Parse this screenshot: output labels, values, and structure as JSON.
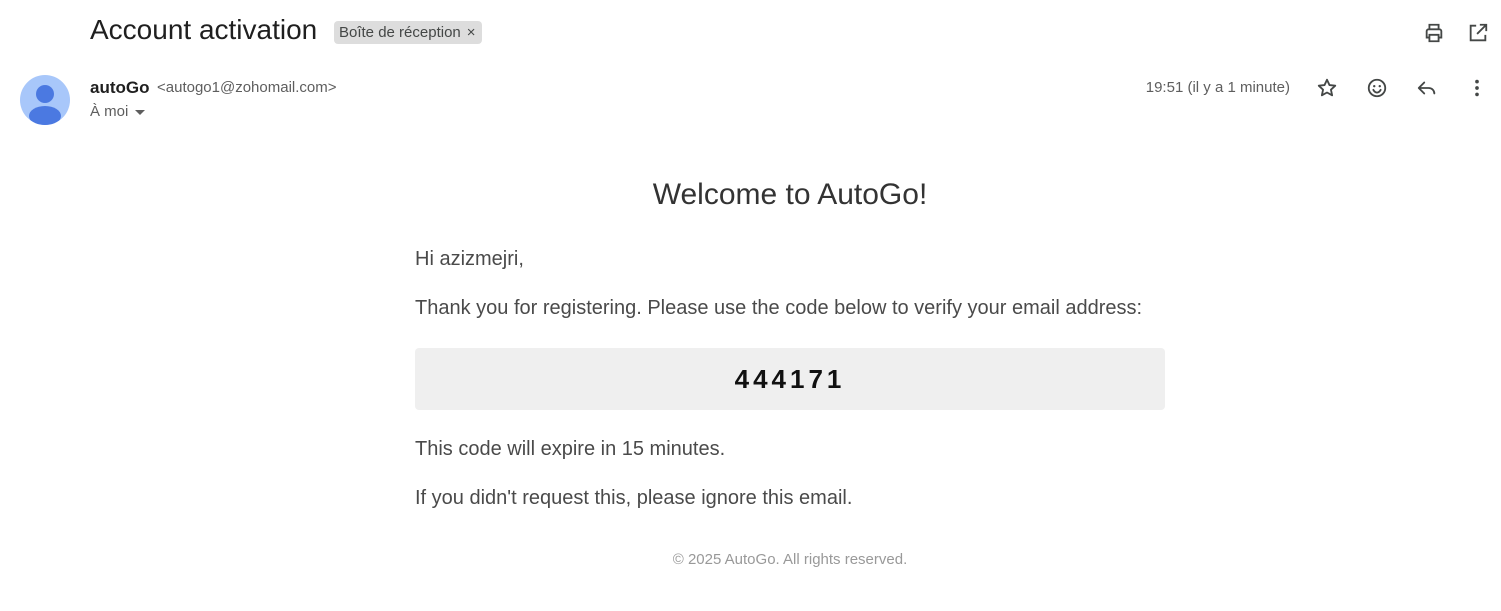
{
  "header": {
    "subject": "Account activation",
    "label_chip": "Boîte de réception",
    "label_chip_close": "×",
    "actions": {
      "print_icon": "print-icon",
      "open_new_window_icon": "open-in-new-window-icon"
    }
  },
  "sender": {
    "name": "autoGo",
    "email": "<autogo1@zohomail.com>",
    "recipient": "À moi",
    "timestamp": "19:51 (il y a 1 minute)",
    "avatar_icon": "default-avatar-icon",
    "actions": [
      "star-icon",
      "emoji-reaction-icon",
      "reply-icon",
      "more-vert-icon"
    ]
  },
  "email": {
    "heading": "Welcome to AutoGo!",
    "greeting": "Hi azizmejri,",
    "instructions": "Thank you for registering. Please use the code below to verify your email address:",
    "code": "444171",
    "expiry": "This code will expire in 15 minutes.",
    "ignore_note": "If you didn't request this, please ignore this email.",
    "footer": "© 2025 AutoGo. All rights reserved."
  },
  "colors": {
    "avatar_bg": "#a8c7fa",
    "avatar_fg": "#4b79e1",
    "chip_bg": "#dddddd",
    "code_box_bg": "#efefef",
    "icon": "#444746"
  }
}
